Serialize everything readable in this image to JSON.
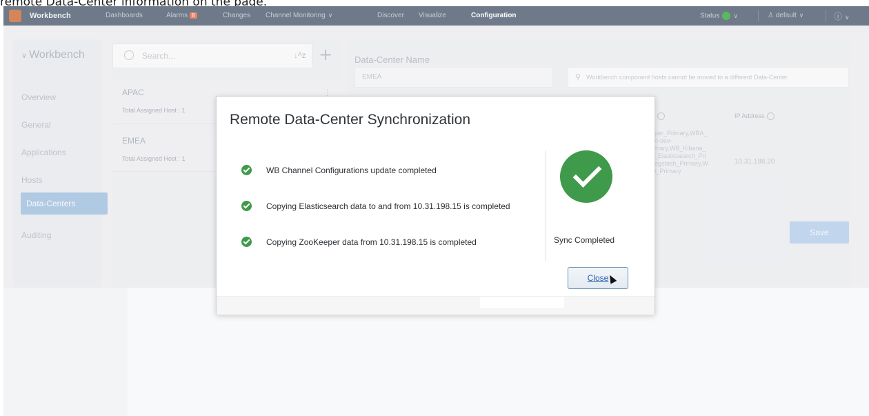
{
  "caption": "remote Data-Center information on the page.",
  "topbar": {
    "brand": "Workbench",
    "nav": [
      "Dashboards",
      "Alarms",
      "Changes",
      "Channel Monitoring",
      "Discover",
      "Visualize",
      "Configuration"
    ],
    "alarm_count": "8",
    "active_nav": "Configuration",
    "status_label": "Status",
    "user_label": "default",
    "help_icon": "question-circle-icon"
  },
  "sidebar": {
    "title": "Workbench",
    "items": [
      "Overview",
      "General",
      "Applications",
      "Hosts",
      "Data-Centers",
      "Auditing"
    ],
    "active": "Data-Centers"
  },
  "list": {
    "search_placeholder": "Search...",
    "cards": [
      {
        "name": "APAC",
        "hosts": "Total Assigned Host : 1"
      },
      {
        "name": "EMEA",
        "hosts": "Total Assigned Host : 1"
      }
    ]
  },
  "detail": {
    "label": "Data-Center Name",
    "name_value": "EMEA",
    "notice": "Workbench component hosts cannot be moved to a different Data-Center",
    "ip_header": "IP Address",
    "components": "per_Primary,WBA_\nn-dev-\nmary,WB_Kibana_\n_Elasticsearch_Pri\nogstash_Primary,W\nt_Primary",
    "ip_value": "10.31.198.20",
    "save_label": "Save"
  },
  "modal": {
    "title": "Remote Data-Center Synchronization",
    "steps": [
      "WB Channel Configurations update completed",
      "Copying Elasticsearch data to and from 10.31.198.15 is completed",
      "Copying ZooKeeper data from 10.31.198.15 is completed"
    ],
    "sync_status": "Sync Completed",
    "close_label": "Close"
  },
  "colors": {
    "success": "#3f9a4b",
    "topbar": "#6e7a8a",
    "active_sidebar": "#a9c7e6",
    "close_text": "#2a5ea8"
  }
}
